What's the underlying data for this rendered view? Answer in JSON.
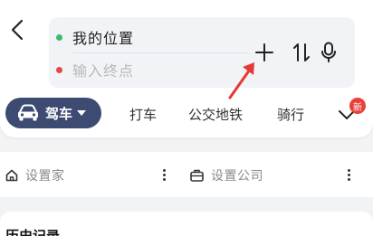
{
  "search": {
    "start_label": "我的位置",
    "end_placeholder": "输入终点"
  },
  "modes": {
    "drive": "驾车",
    "bus": "打车",
    "metro": "公交地铁",
    "bike": "骑行",
    "new_badge": "新"
  },
  "quick": {
    "home": "设置家",
    "company": "设置公司"
  },
  "history": {
    "title": "历史记录"
  },
  "icons": {
    "back": "chevron-left-icon",
    "add": "plus-icon",
    "swap": "swap-vertical-icon",
    "mic": "microphone-icon",
    "car": "car-icon",
    "more": "chevron-down-icon",
    "home": "home-icon",
    "company": "briefcase-icon"
  },
  "colors": {
    "accent": "#3d4b72",
    "start_dot": "#3dbb6b",
    "end_dot": "#e64848",
    "badge": "#e8413c",
    "annotation": "#e53935"
  }
}
